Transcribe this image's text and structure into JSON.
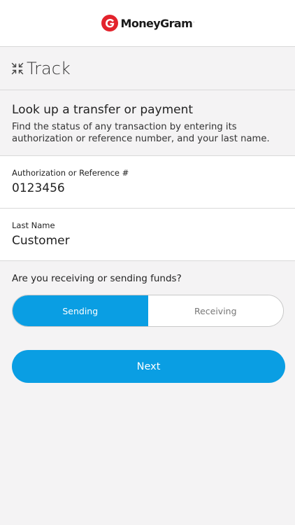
{
  "header": {
    "brand": "MoneyGram",
    "brand_mark": ".",
    "logo_icon": "moneygram-logo-icon",
    "colors": {
      "logo_red": "#e3232c"
    }
  },
  "track": {
    "title": "Track",
    "icon": "collapse-arrows-icon"
  },
  "intro": {
    "title": "Look up a transfer or payment",
    "description": "Find the status of any transaction by entering its authorization or reference number, and your last name."
  },
  "fields": {
    "reference": {
      "label": "Authorization or Reference #",
      "value": "0123456"
    },
    "last_name": {
      "label": "Last Name",
      "value": "Customer"
    }
  },
  "direction": {
    "question": "Are you receiving or sending funds?",
    "options": [
      "Sending",
      "Receiving"
    ],
    "selected": "Sending"
  },
  "actions": {
    "next_label": "Next"
  },
  "colors": {
    "accent": "#0a9ee3",
    "background": "#f4f3f4"
  }
}
